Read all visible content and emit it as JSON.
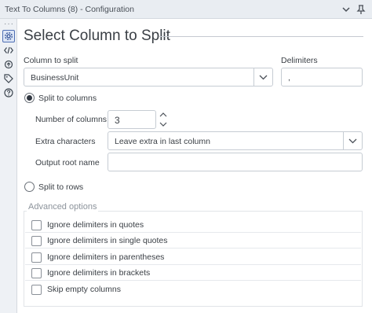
{
  "window": {
    "title": "Text To Columns (8) - Configuration"
  },
  "main": {
    "heading": "Select Column to Split",
    "column_to_split": {
      "label": "Column to split",
      "value": "BusinessUnit"
    },
    "delimiters": {
      "label": "Delimiters",
      "value": ","
    },
    "split_to_columns": {
      "label": "Split to columns",
      "selected": true
    },
    "number_of_columns": {
      "label": "Number of columns",
      "value": "3"
    },
    "extra_characters": {
      "label": "Extra characters",
      "value": "Leave extra in last column"
    },
    "output_root_name": {
      "label": "Output root name",
      "value": ""
    },
    "split_to_rows": {
      "label": "Split to rows",
      "selected": false
    },
    "advanced": {
      "title": "Advanced options",
      "options": [
        {
          "label": "Ignore delimiters in quotes",
          "checked": false
        },
        {
          "label": "Ignore delimiters in single quotes",
          "checked": false
        },
        {
          "label": "Ignore delimiters in parentheses",
          "checked": false
        },
        {
          "label": "Ignore delimiters in brackets",
          "checked": false
        },
        {
          "label": "Skip empty columns",
          "checked": false
        }
      ]
    }
  },
  "icons": {
    "titlebar": [
      "chevron-down-icon",
      "pin-icon"
    ],
    "rail": [
      "more-icon",
      "gear-icon",
      "code-icon",
      "refresh-icon",
      "tag-icon",
      "help-icon"
    ]
  }
}
